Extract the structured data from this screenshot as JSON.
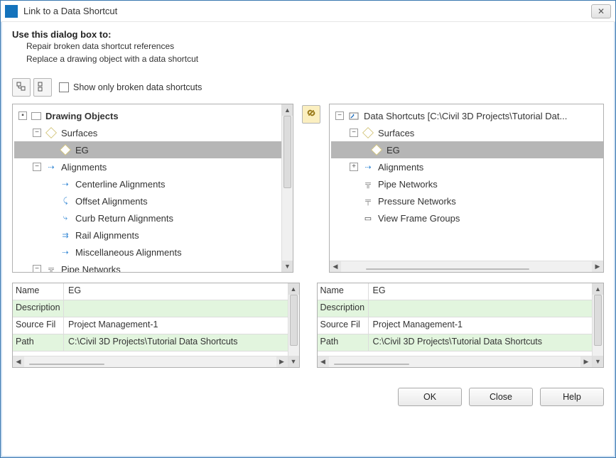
{
  "window": {
    "title": "Link to a Data Shortcut"
  },
  "instructions": {
    "heading": "Use this dialog box to:",
    "line1": "Repair broken data shortcut references",
    "line2": "Replace a drawing object with a data shortcut"
  },
  "toolbar": {
    "checkbox_label": "Show only broken data shortcuts"
  },
  "left_tree": {
    "root": "Drawing Objects",
    "surfaces": "Surfaces",
    "eg": "EG",
    "alignments": "Alignments",
    "centerline": "Centerline Alignments",
    "offset": "Offset Alignments",
    "curb": "Curb Return Alignments",
    "rail": "Rail Alignments",
    "misc": "Miscellaneous Alignments",
    "pipe": "Pipe Networks"
  },
  "right_tree": {
    "root": "Data Shortcuts [C:\\Civil 3D Projects\\Tutorial Dat...",
    "surfaces": "Surfaces",
    "eg": "EG",
    "alignments": "Alignments",
    "pipe": "Pipe Networks",
    "pressure": "Pressure Networks",
    "viewframe": "View Frame Groups"
  },
  "props": {
    "name_k": "Name",
    "name_v": "EG",
    "desc_k": "Description",
    "desc_v": "",
    "src_k": "Source Fil",
    "src_v": "Project Management-1",
    "path_k": "Path",
    "path_v": "C:\\Civil 3D Projects\\Tutorial Data Shortcuts"
  },
  "buttons": {
    "ok": "OK",
    "close": "Close",
    "help": "Help"
  }
}
